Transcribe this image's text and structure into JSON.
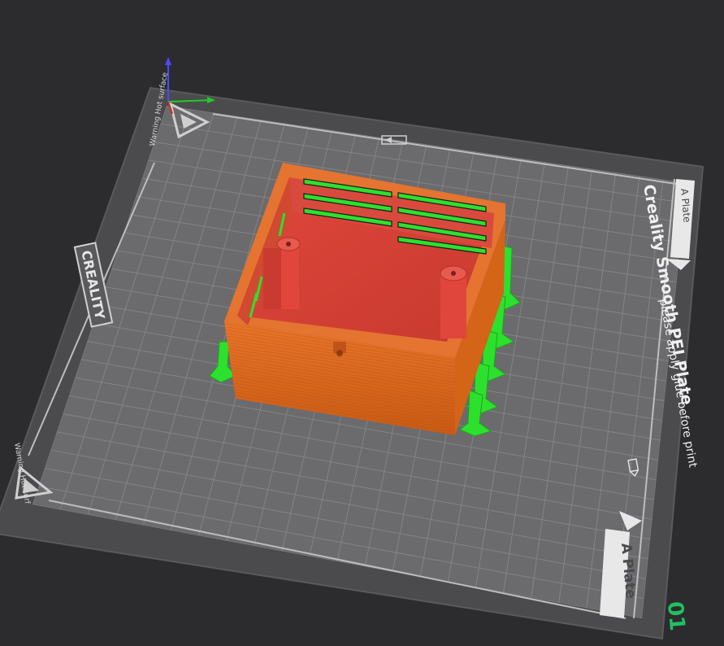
{
  "plate": {
    "brand": "CREALITY",
    "title": "Creality Smooth PEI Plate",
    "note": "please apply glue before print",
    "side_label_top": "A Plate",
    "side_label_bottom": "A Plate",
    "warning_top": "Warning Hot surface",
    "warning_bottom": "Warning Hot surf",
    "plate_number": "01"
  },
  "colors": {
    "background": "#2c2c2f",
    "plate_frame": "#4a4a4d",
    "plate_surface": "#6a6a6d",
    "grid": "#8a8a8d",
    "model_wall": "#e06a1e",
    "model_inner": "#d7463a",
    "support": "#2ee02e",
    "plate_number": "#20c060"
  },
  "icons": [
    "warning-triangle-icon",
    "axis-gizmo-icon",
    "glue-pen-icon",
    "plate-arrow-icon"
  ]
}
